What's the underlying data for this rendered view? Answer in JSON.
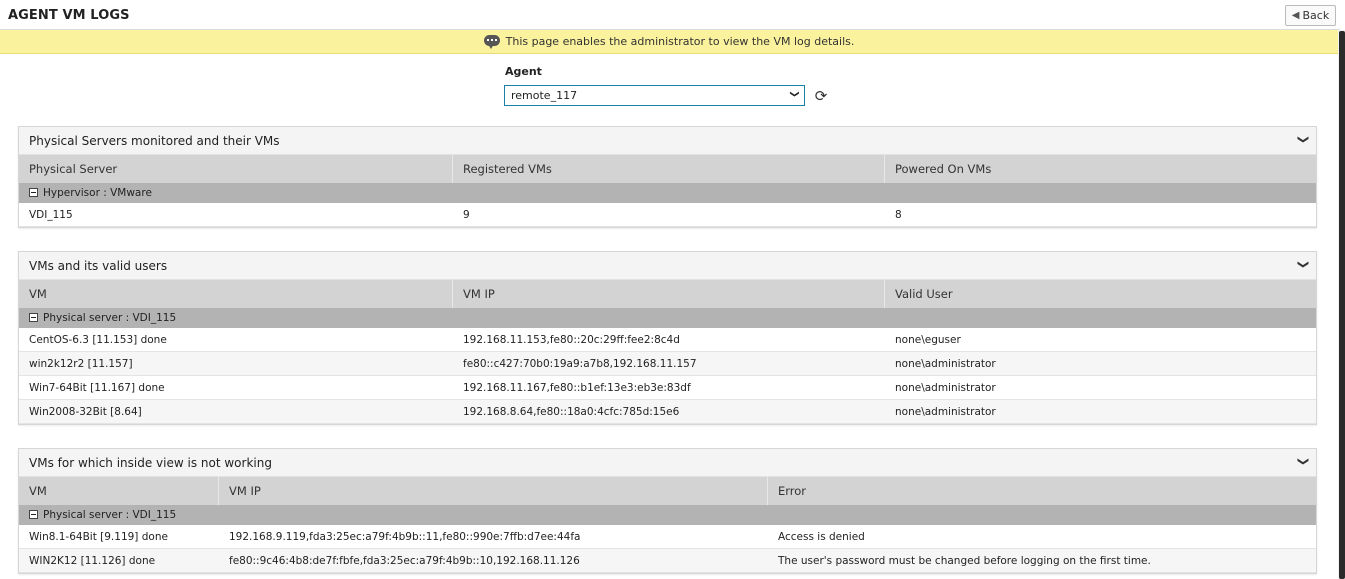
{
  "header": {
    "title": "AGENT VM LOGS",
    "back_label": "Back"
  },
  "info": {
    "message": "This page enables the administrator to view the VM log details."
  },
  "agent": {
    "label": "Agent",
    "selected": "remote_117"
  },
  "panels": [
    {
      "title": "Physical Servers monitored and their VMs",
      "columns": [
        "Physical Server",
        "Registered VMs",
        "Powered On VMs"
      ],
      "group": "Hypervisor : VMware",
      "rows": [
        [
          "VDI_115",
          "9",
          "8"
        ]
      ]
    },
    {
      "title": "VMs and its valid users",
      "columns": [
        "VM",
        "VM IP",
        "Valid User"
      ],
      "group": "Physical server : VDI_115",
      "rows": [
        [
          "CentOS-6.3 [11.153] done",
          "192.168.11.153,fe80::20c:29ff:fee2:8c4d",
          "none\\eguser"
        ],
        [
          "win2k12r2 [11.157]",
          "fe80::c427:70b0:19a9:a7b8,192.168.11.157",
          "none\\administrator"
        ],
        [
          "Win7-64Bit [11.167] done",
          "192.168.11.167,fe80::b1ef:13e3:eb3e:83df",
          "none\\administrator"
        ],
        [
          "Win2008-32Bit [8.64]",
          "192.168.8.64,fe80::18a0:4cfc:785d:15e6",
          "none\\administrator"
        ]
      ]
    },
    {
      "title": "VMs for which inside view is not working",
      "columns": [
        "VM",
        "VM IP",
        "Error"
      ],
      "group": "Physical server : VDI_115",
      "rows": [
        [
          "Win8.1-64Bit [9.119] done",
          "192.168.9.119,fda3:25ec:a79f:4b9b::11,fe80::990e:7ffb:d7ee:44fa",
          "Access is denied"
        ],
        [
          "WIN2K12 [11.126] done",
          "fe80::9c46:4b8:de7f:fbfe,fda3:25ec:a79f:4b9b::10,192.168.11.126",
          "The user's password must be changed before logging on the first time."
        ]
      ]
    }
  ]
}
